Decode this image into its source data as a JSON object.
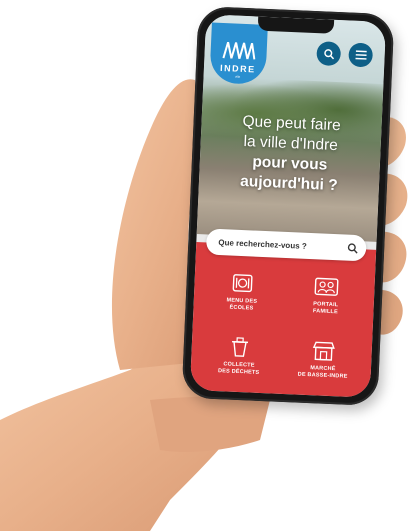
{
  "brand": {
    "logo_text": "INDRE",
    "logo_sub": "ville"
  },
  "header": {
    "search_icon": "search-icon",
    "menu_icon": "hamburger-menu-icon"
  },
  "hero": {
    "line1": "Que peut faire",
    "line2": "la ville d'Indre",
    "line3": "pour vous",
    "line4": "aujourd'hui ?"
  },
  "search": {
    "placeholder": "Que recherchez-vous ?",
    "icon": "search-icon"
  },
  "tiles": [
    {
      "label_1": "MENU DES",
      "label_2": "ÉCOLES",
      "icon": "school-menu-icon"
    },
    {
      "label_1": "PORTAIL",
      "label_2": "FAMILLE",
      "icon": "family-portal-icon"
    },
    {
      "label_1": "COLLECTE",
      "label_2": "DES DÉCHETS",
      "icon": "waste-collection-icon"
    },
    {
      "label_1": "MARCHÉ",
      "label_2": "DE BASSE-INDRE",
      "icon": "market-icon"
    }
  ],
  "colors": {
    "brand_blue": "#2a8fd0",
    "button_blue": "#0e5f87",
    "accent_red": "#d93b3d"
  }
}
